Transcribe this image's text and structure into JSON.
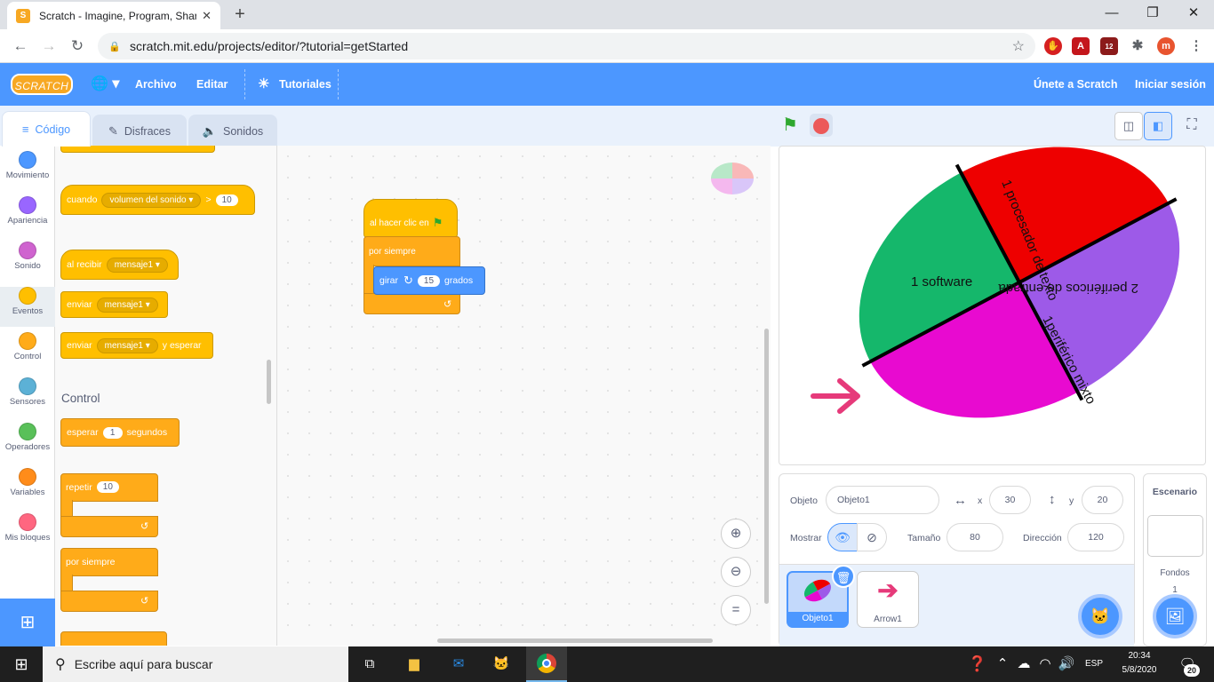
{
  "browser": {
    "tab_title": "Scratch - Imagine, Program, Shar",
    "url": "scratch.mit.edu/projects/editor/?tutorial=getStarted",
    "ext_badge": "12",
    "profile_initial": "m"
  },
  "menu": {
    "logo": "SCRATCH",
    "archivo": "Archivo",
    "editar": "Editar",
    "tutoriales": "Tutoriales",
    "join": "Únete a Scratch",
    "signin": "Iniciar sesión"
  },
  "tabs": {
    "code": "Código",
    "costumes": "Disfraces",
    "sounds": "Sonidos"
  },
  "categories": [
    {
      "label": "Movimiento",
      "color": "#4c97ff"
    },
    {
      "label": "Apariencia",
      "color": "#9966ff"
    },
    {
      "label": "Sonido",
      "color": "#cf63cf"
    },
    {
      "label": "Eventos",
      "color": "#ffbf00"
    },
    {
      "label": "Control",
      "color": "#ffab19"
    },
    {
      "label": "Sensores",
      "color": "#5cb1d6"
    },
    {
      "label": "Operadores",
      "color": "#59c059"
    },
    {
      "label": "Variables",
      "color": "#ff8c1a"
    },
    {
      "label": "Mis bloques",
      "color": "#ff6680"
    }
  ],
  "palette": {
    "when_label": "cuando",
    "when_dd": "volumen del sonido",
    "when_op": ">",
    "when_val": "10",
    "receive_label": "al recibir",
    "receive_dd": "mensaje1",
    "send_label": "enviar",
    "send_dd": "mensaje1",
    "send_wait_label": "enviar",
    "send_wait_dd": "mensaje1",
    "send_wait_suffix": "y esperar",
    "control_header": "Control",
    "wait_label": "esperar",
    "wait_val": "1",
    "wait_suffix": "segundos",
    "repeat_label": "repetir",
    "repeat_val": "10",
    "forever_label": "por siempre"
  },
  "script": {
    "hat_label": "al hacer clic en",
    "forever_label": "por siempre",
    "turn_label": "girar",
    "turn_val": "15",
    "turn_suffix": "grados"
  },
  "stage": {
    "sector_green": "1 procesador de texto",
    "sector_red": "2 periféricos de entrada",
    "sector_magenta": "1 software",
    "sector_purple": "1periférico mixto"
  },
  "sprite_info": {
    "object_label": "Objeto",
    "object_name": "Objeto1",
    "x_label": "x",
    "x_val": "30",
    "y_label": "y",
    "y_val": "20",
    "show_label": "Mostrar",
    "size_label": "Tamaño",
    "size_val": "80",
    "dir_label": "Dirección",
    "dir_val": "120"
  },
  "sprites": [
    {
      "name": "Objeto1"
    },
    {
      "name": "Arrow1"
    }
  ],
  "stage_panel": {
    "title": "Escenario",
    "backdrops_label": "Fondos",
    "backdrops_count": "1"
  },
  "taskbar": {
    "search_placeholder": "Escribe aquí para buscar",
    "lang": "ESP",
    "time": "20:34",
    "date": "5/8/2020",
    "notif_count": "20"
  }
}
